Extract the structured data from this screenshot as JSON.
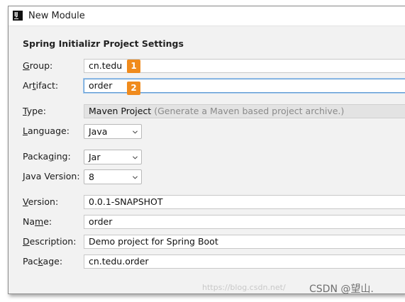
{
  "window": {
    "title": "New Module",
    "app_icon": "intellij-icon"
  },
  "heading": "Spring Initializr Project Settings",
  "fields": {
    "group": {
      "label_before": "",
      "label_mnemonic": "G",
      "label_after": "roup:",
      "value": "cn.tedu",
      "badge": "1"
    },
    "artifact": {
      "label_before": "Ar",
      "label_mnemonic": "t",
      "label_after": "ifact:",
      "value": "order",
      "badge": "2"
    },
    "type": {
      "label_before": "",
      "label_mnemonic": "T",
      "label_after": "ype:",
      "value": "Maven Project",
      "hint": "(Generate a Maven based project archive.)"
    },
    "language": {
      "label_before": "",
      "label_mnemonic": "L",
      "label_after": "anguage:",
      "value": "Java"
    },
    "packaging": {
      "label_before": "Packa",
      "label_mnemonic": "g",
      "label_after": "ing:",
      "value": "Jar"
    },
    "java_version": {
      "label_before": "",
      "label_mnemonic": "J",
      "label_after": "ava Version:",
      "value": "8"
    },
    "version": {
      "label_before": "",
      "label_mnemonic": "V",
      "label_after": "ersion:",
      "value": "0.0.1-SNAPSHOT"
    },
    "name": {
      "label_before": "Na",
      "label_mnemonic": "m",
      "label_after": "e:",
      "value": "order"
    },
    "description": {
      "label_before": "",
      "label_mnemonic": "D",
      "label_after": "escription:",
      "value": "Demo project for Spring Boot"
    },
    "package": {
      "label_before": "Pac",
      "label_mnemonic": "k",
      "label_after": "age:",
      "value": "cn.tedu.order"
    }
  },
  "watermark": {
    "url": "https://blog.csdn.net/",
    "brand": "CSDN @望山."
  },
  "colors": {
    "badge": "#f08b1d",
    "focus_border": "#5f9bd3",
    "dialog_bg": "#f2f2f2"
  }
}
